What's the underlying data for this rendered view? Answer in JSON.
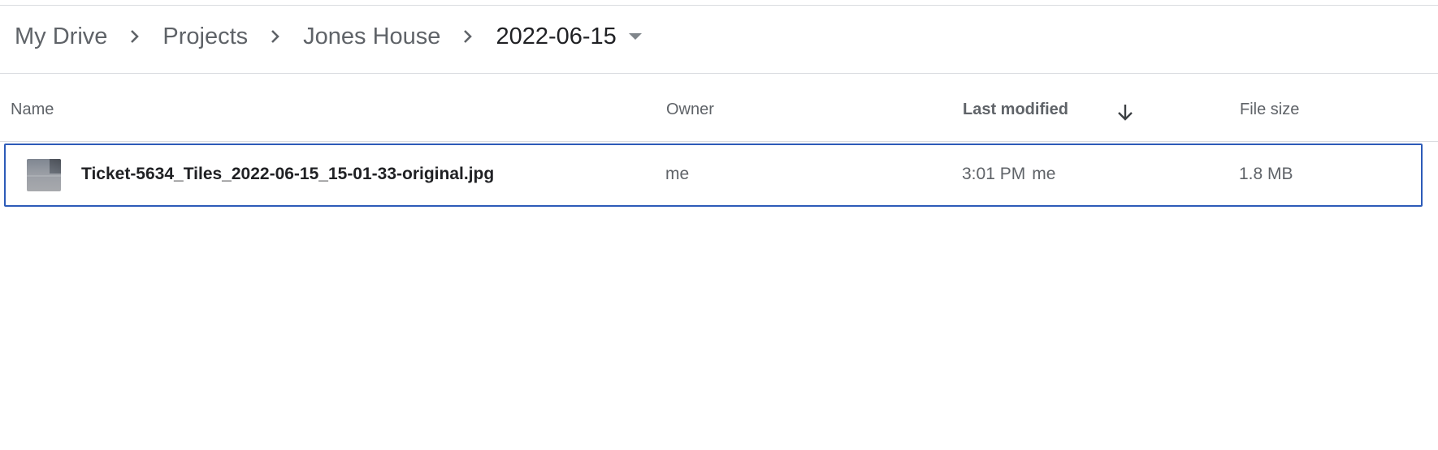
{
  "breadcrumb": {
    "items": [
      {
        "label": "My Drive"
      },
      {
        "label": "Projects"
      },
      {
        "label": "Jones House"
      },
      {
        "label": "2022-06-15"
      }
    ],
    "separator_icon": "chevron-right-icon",
    "dropdown_icon": "caret-down-icon"
  },
  "table": {
    "columns": {
      "name": "Name",
      "owner": "Owner",
      "last_modified": "Last modified",
      "file_size": "File size"
    },
    "sort_icon": "arrow-down-icon",
    "rows": [
      {
        "name": "Ticket-5634_Tiles_2022-06-15_15-01-33-original.jpg",
        "owner": "me",
        "modified_time": "3:01 PM",
        "modified_by": "me",
        "size": "1.8 MB",
        "selected": true
      }
    ]
  },
  "colors": {
    "selection_border": "#2d5bb8",
    "divider": "#dadce0",
    "text_secondary": "#5f6368",
    "text_primary": "#202124"
  }
}
